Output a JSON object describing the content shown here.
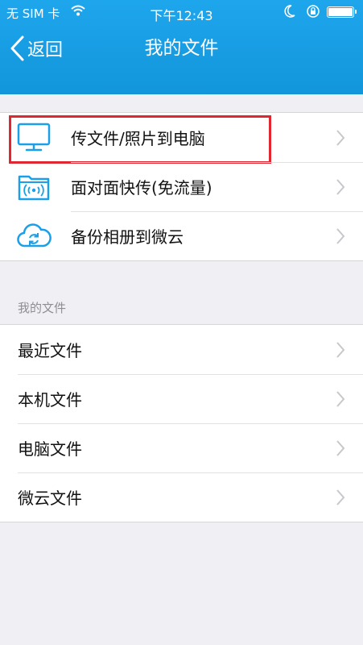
{
  "status_bar": {
    "carrier": "无 SIM 卡",
    "time": "下午12:43"
  },
  "nav": {
    "back_label": "返回",
    "title": "我的文件"
  },
  "top_group": {
    "items": [
      {
        "label": "传文件/照片到电脑",
        "icon": "monitor-icon"
      },
      {
        "label": "面对面快传(免流量)",
        "icon": "wireless-folder-icon"
      },
      {
        "label": "备份相册到微云",
        "icon": "cloud-sync-icon"
      }
    ]
  },
  "files_section": {
    "header": "我的文件",
    "items": [
      {
        "label": "最近文件"
      },
      {
        "label": "本机文件"
      },
      {
        "label": "电脑文件"
      },
      {
        "label": "微云文件"
      }
    ]
  },
  "colors": {
    "nav_bar": "#1295db",
    "icon_accent": "#1aa0e8",
    "highlight": "#e0262f",
    "background": "#efeff4"
  }
}
